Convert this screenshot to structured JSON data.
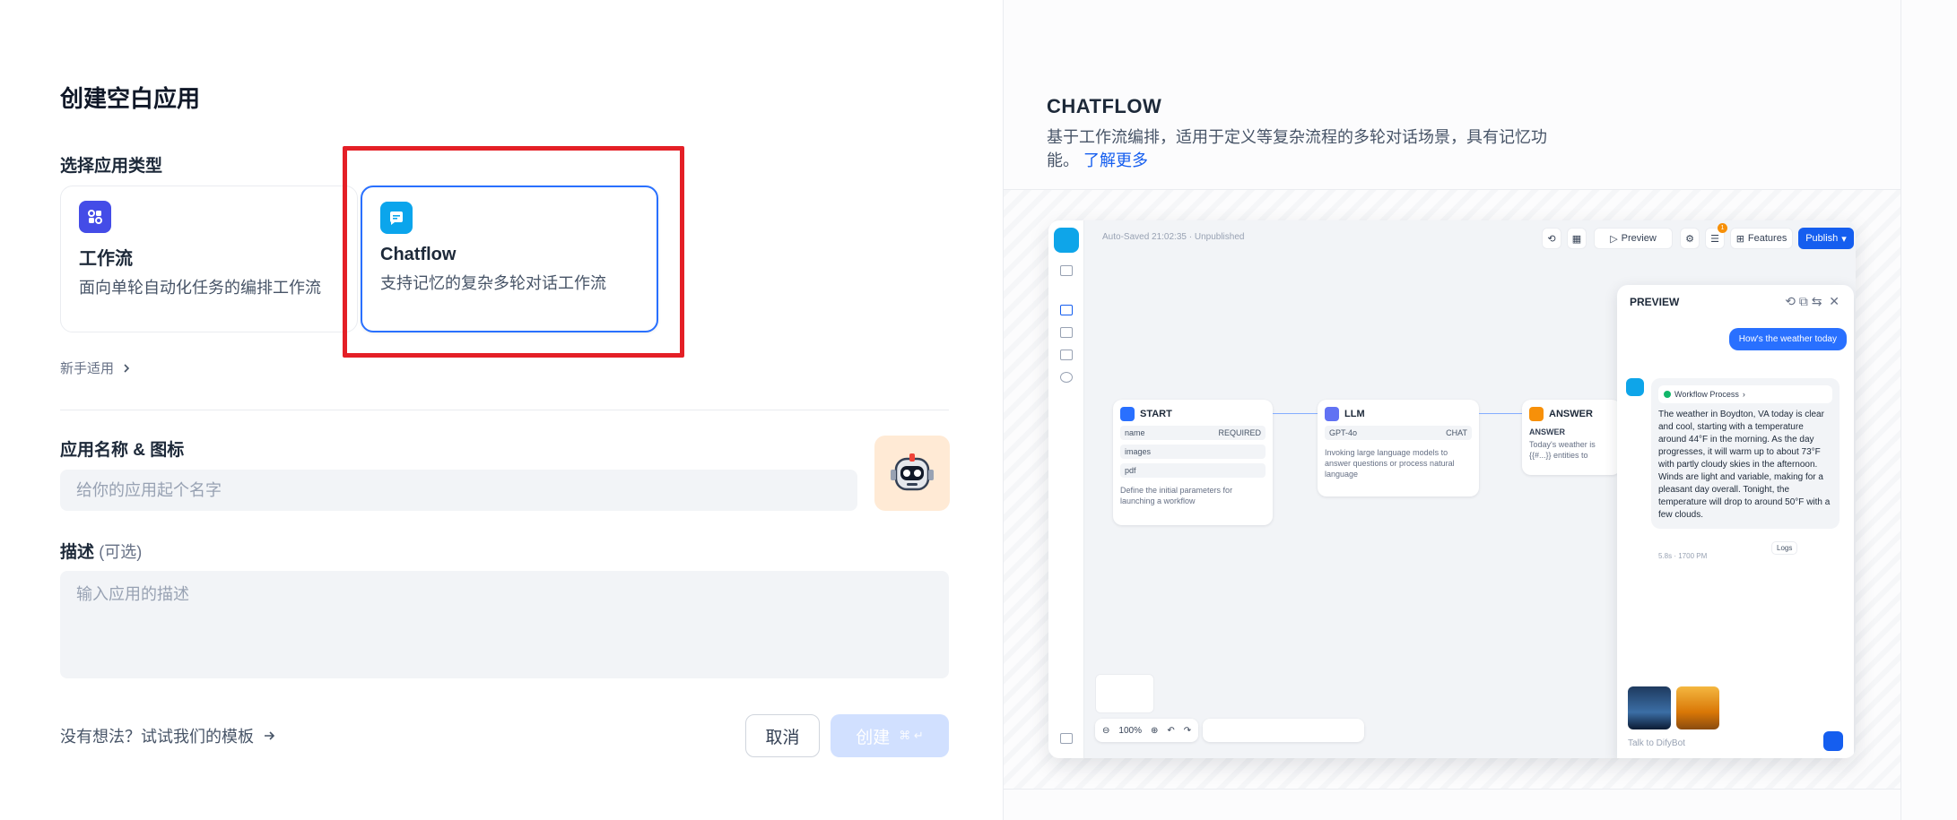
{
  "left": {
    "title": "创建空白应用",
    "type_label": "选择应用类型",
    "cards": [
      {
        "name": "工作流",
        "desc": "面向单轮自动化任务的编排工作流",
        "icon": "workflow-icon",
        "color": "#444ce7"
      },
      {
        "name": "Chatflow",
        "desc": "支持记忆的复杂多轮对话工作流",
        "icon": "chatflow-icon",
        "color": "#0ba5ec"
      }
    ],
    "novice": "新手适用",
    "name_label": "应用名称 & 图标",
    "name_placeholder": "给你的应用起个名字",
    "desc_label": "描述",
    "desc_optional": "(可选)",
    "desc_placeholder": "输入应用的描述",
    "template_link": "没有想法？试试我们的模板",
    "cancel": "取消",
    "create": "创建",
    "create_kbd": "⌘ ↵",
    "avatar_icon": "robot-avatar-icon"
  },
  "right": {
    "title": "CHATFLOW",
    "desc": "基于工作流编排，适用于定义等复杂流程的多轮对话场景，具有记忆功能。",
    "learn_more": "了解更多",
    "preview": {
      "autosave": "Auto-Saved 21:02:35 · Unpublished",
      "btn_preview": "Preview",
      "btn_features": "Features",
      "btn_publish": "Publish",
      "badge_count": "1",
      "nodes": {
        "start": {
          "title": "START",
          "rows": [
            {
              "name": "name",
              "tag": "REQUIRED"
            },
            {
              "name": "images",
              "tag": ""
            },
            {
              "name": "pdf",
              "tag": ""
            }
          ],
          "desc": "Define the initial parameters for launching a workflow"
        },
        "llm": {
          "title": "LLM",
          "model": "GPT-4o",
          "tag": "CHAT",
          "desc": "Invoking large language models to answer questions or process natural language"
        },
        "answer": {
          "title": "ANSWER",
          "label": "ANSWER",
          "desc": "Today's weather is {{#...}} entities to extract."
        }
      },
      "panel_title": "PREVIEW",
      "user_msg": "How's the weather today",
      "workflow_process": "Workflow Process",
      "bot_answer": "The weather in Boydton, VA today is clear and cool, starting with a temperature around 44°F in the morning. As the day progresses, it will warm up to about 73°F with partly cloudy skies in the afternoon. Winds are light and variable, making for a pleasant day overall. Tonight, the temperature will drop to around 50°F with a few clouds.",
      "meta": "5.8s · 1700 PM",
      "logs": "Logs",
      "chat_placeholder": "Talk to DifyBot",
      "zoom": "100%"
    }
  }
}
